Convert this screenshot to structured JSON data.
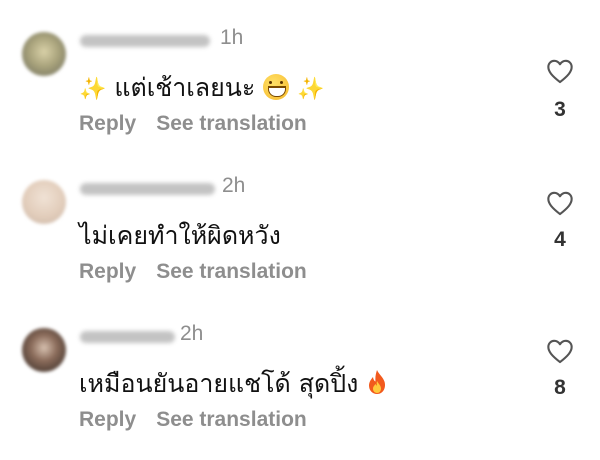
{
  "comments": [
    {
      "time": "1h",
      "text": "แต่เช้าเลยนะ",
      "text_prefix_emoji": "sparkles-icon",
      "text_suffix_emoji": "grinning-face-icon",
      "text_trailing_emoji": "sparkles-icon",
      "reply_label": "Reply",
      "translate_label": "See translation",
      "likes": "3",
      "avatar_color": "#a9a37c"
    },
    {
      "time": "2h",
      "text": "ไม่เคยทำให้ผิดหวัง",
      "reply_label": "Reply",
      "translate_label": "See translation",
      "likes": "4",
      "avatar_color": "#e2cdbb"
    },
    {
      "time": "2h",
      "text": "เหมือนยันอายแชโด้ สุดปิ้ง",
      "text_suffix_emoji": "fire-icon",
      "reply_label": "Reply",
      "translate_label": "See translation",
      "likes": "8",
      "avatar_color": "#5a4a40"
    }
  ],
  "colors": {
    "meta_text": "#8e8e8e",
    "body_text": "#111111",
    "background": "#ffffff"
  }
}
